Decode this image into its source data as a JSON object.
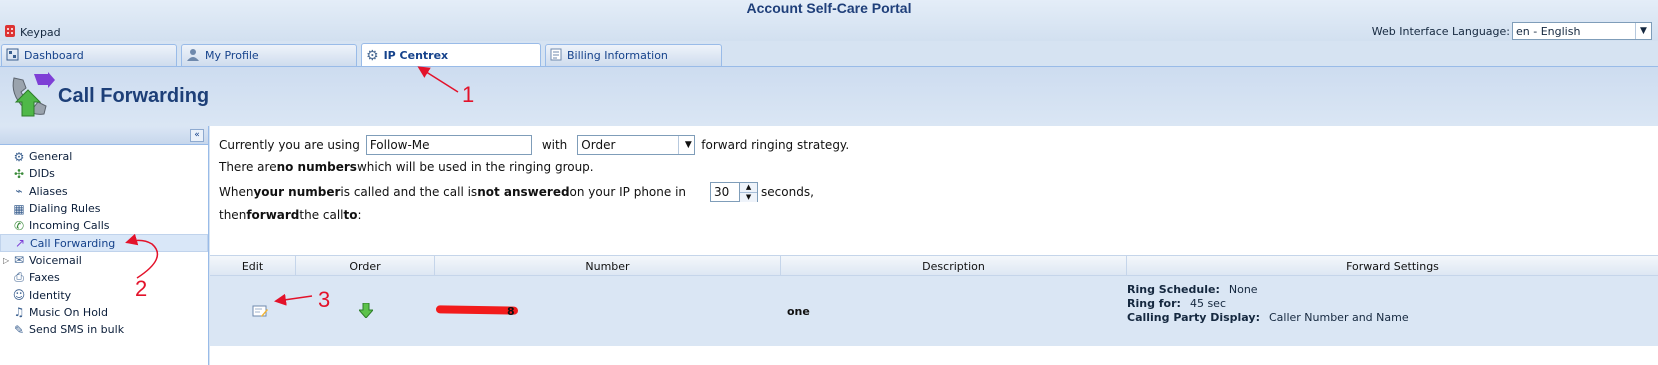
{
  "header": {
    "portal_title": "Account Self-Care Portal",
    "keypad_label": "Keypad",
    "language_label": "Web Interface Language:",
    "language_value": "en - English"
  },
  "tabs": [
    {
      "label": "Dashboard",
      "icon": "dashboard-icon",
      "active": false
    },
    {
      "label": "My Profile",
      "icon": "user-icon",
      "active": false
    },
    {
      "label": "IP Centrex",
      "icon": "gear-icon",
      "active": true
    },
    {
      "label": "Billing Information",
      "icon": "document-icon",
      "active": false
    }
  ],
  "page": {
    "title": "Call Forwarding",
    "icon": "call-forwarding-icon"
  },
  "sidebar": {
    "collapse_icon": "double-chevron-left-icon",
    "items": [
      {
        "label": "General",
        "icon": "gear-icon"
      },
      {
        "label": "DIDs",
        "icon": "network-icon"
      },
      {
        "label": "Aliases",
        "icon": "tag-icon"
      },
      {
        "label": "Dialing Rules",
        "icon": "keypad-icon"
      },
      {
        "label": "Incoming Calls",
        "icon": "incoming-call-icon"
      },
      {
        "label": "Call Forwarding",
        "icon": "call-forwarding-icon",
        "selected": true
      },
      {
        "label": "Voicemail",
        "icon": "voicemail-icon",
        "expandable": true
      },
      {
        "label": "Faxes",
        "icon": "fax-icon"
      },
      {
        "label": "Identity",
        "icon": "identity-icon"
      },
      {
        "label": "Music On Hold",
        "icon": "music-icon"
      },
      {
        "label": "Send SMS in bulk",
        "icon": "sms-icon"
      }
    ]
  },
  "main": {
    "line1_prefix": "Currently you are using",
    "mode_value": "Follow-Me",
    "line1_with": "with",
    "strategy_value": "Order",
    "line1_suffix": "forward ringing strategy.",
    "line2_a": "There are ",
    "line2_b": "no numbers",
    "line2_c": " which will be used in the ringing group.",
    "line3_a": "When ",
    "line3_b": "your number",
    "line3_c": " is called and the call is ",
    "line3_d": "not answered",
    "line3_e": " on your IP phone in",
    "timeout_value": "30",
    "line3_suffix": "seconds,",
    "line4_a": "then ",
    "line4_b": "forward",
    "line4_c": " the call ",
    "line4_d": "to",
    "line4_e": " :"
  },
  "grid": {
    "columns": [
      "Edit",
      "Order",
      "Number",
      "Description",
      "Forward Settings"
    ],
    "rows": [
      {
        "edit_icon": "edit-icon",
        "order_icon": "arrow-down-icon",
        "number_tail": "8",
        "description": "one",
        "settings": [
          {
            "label": "Ring Schedule:",
            "value": "None"
          },
          {
            "label": "Ring for:",
            "value": "45 sec"
          },
          {
            "label": "Calling Party Display:",
            "value": "Caller Number and Name"
          }
        ]
      }
    ]
  },
  "annotations": [
    "1",
    "2",
    "3"
  ],
  "colors": {
    "accent": "#1d3f78",
    "annotation": "#e3122a",
    "selected": "#d9e7f8"
  }
}
